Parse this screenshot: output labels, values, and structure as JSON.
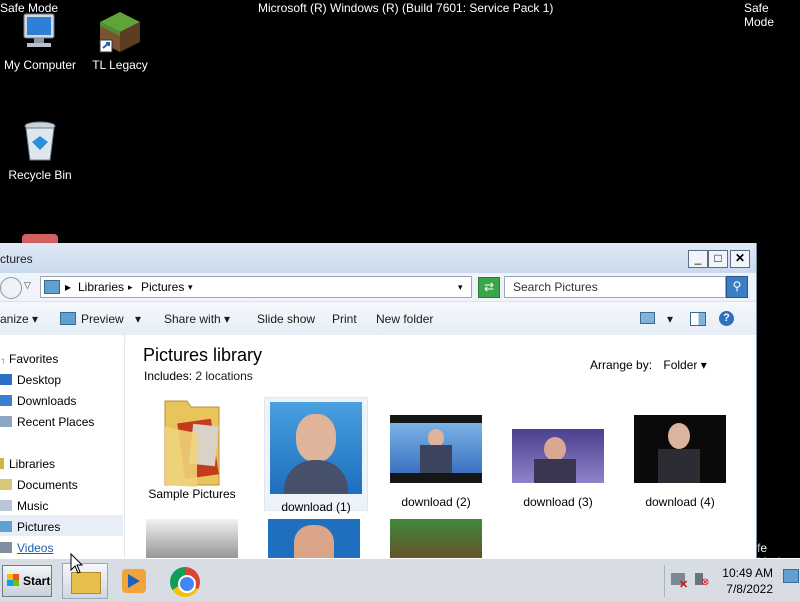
{
  "screen": {
    "safe_mode_left": "Safe Mode",
    "safe_mode_right": "Safe Mode",
    "safe_mode_lower_right": "fe Mode",
    "os_banner": "Microsoft (R) Windows (R) (Build 7601: Service Pack 1)"
  },
  "desktop": {
    "icons": [
      {
        "label": "My Computer",
        "icon": "computer-icon"
      },
      {
        "label": "TL Legacy",
        "icon": "minecraft-grass-block-icon"
      },
      {
        "label": "Recycle Bin",
        "icon": "recycle-bin-icon"
      }
    ]
  },
  "window": {
    "title": "ctures",
    "breadcrumb": [
      "Libraries",
      "Pictures"
    ],
    "search_placeholder": "Search Pictures",
    "toolbar": {
      "organize": "anize",
      "preview": "Preview",
      "share_with": "Share with",
      "slide_show": "Slide show",
      "print": "Print",
      "new_folder": "New folder"
    },
    "nav": {
      "favorites": "Favorites",
      "desktop": "Desktop",
      "downloads": "Downloads",
      "recent_places": "Recent Places",
      "libraries": "Libraries",
      "documents": "Documents",
      "music": "Music",
      "pictures": "Pictures",
      "videos": "Videos"
    },
    "library": {
      "title": "Pictures library",
      "includes_label": "Includes:",
      "includes_value": "2 locations",
      "arrange_label": "Arrange by:",
      "arrange_value": "Folder"
    },
    "items": [
      {
        "caption": "Sample Pictures",
        "kind": "folder"
      },
      {
        "caption": "download (1)",
        "kind": "image"
      },
      {
        "caption": "download (2)",
        "kind": "image"
      },
      {
        "caption": "download (3)",
        "kind": "image"
      },
      {
        "caption": "download (4)",
        "kind": "image"
      }
    ]
  },
  "taskbar": {
    "start_label": "Start",
    "pinned": [
      "explorer-icon",
      "media-player-icon",
      "chrome-icon"
    ],
    "time": "10:49 AM",
    "date": "7/8/2022"
  },
  "colors": {
    "desktop_bg": "#000000",
    "window_chrome": "#c9d9ee",
    "selected_nav": "#e8eef7",
    "link_blue": "#1b5fb0"
  }
}
